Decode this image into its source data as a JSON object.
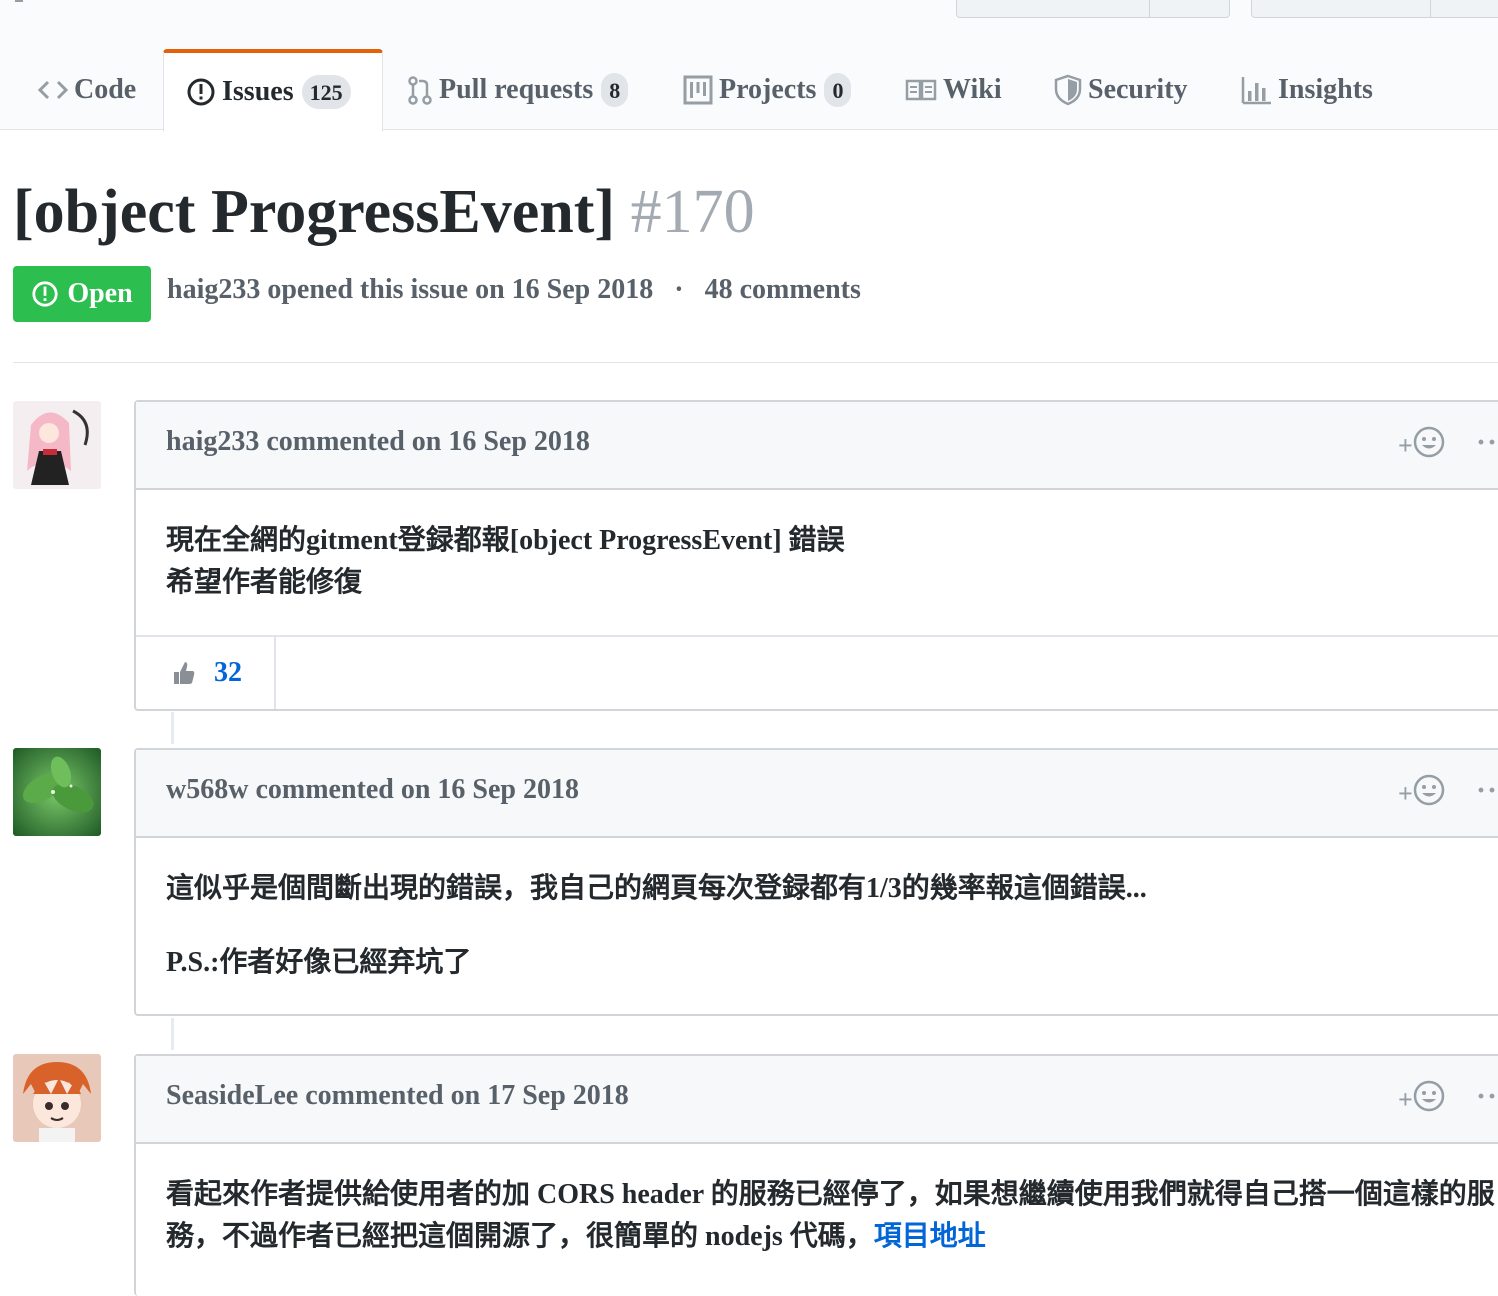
{
  "tabs": [
    {
      "label": "Code",
      "icon": "code-icon"
    },
    {
      "label": "Issues",
      "icon": "issue-opened-icon",
      "count": "125",
      "selected": true
    },
    {
      "label": "Pull requests",
      "icon": "git-pull-request-icon",
      "count": "8"
    },
    {
      "label": "Projects",
      "icon": "project-icon",
      "count": "0"
    },
    {
      "label": "Wiki",
      "icon": "book-icon"
    },
    {
      "label": "Security",
      "icon": "shield-icon"
    },
    {
      "label": "Insights",
      "icon": "graph-icon"
    }
  ],
  "issue": {
    "title": "[object ProgressEvent]",
    "number": "#170",
    "state": "Open",
    "author": "haig233",
    "opened_text": "opened this issue on 16 Sep 2018",
    "separator": "·",
    "comments_count": "48 comments"
  },
  "comments": [
    {
      "author": "haig233",
      "action": "commented",
      "date": "on 16 Sep 2018",
      "lines": [
        "現在全網的gitment登録都報[object ProgressEvent] 錯誤",
        "希望作者能修復"
      ],
      "reaction": {
        "icon": "thumbs-up-icon",
        "count": "32"
      }
    },
    {
      "author": "w568w",
      "action": "commented",
      "date": "on 16 Sep 2018",
      "lines": [
        "這似乎是個間斷出現的錯誤，我自己的網頁每次登録都有1/3的幾率報這個錯誤...",
        "P.S.:作者好像已經弃坑了"
      ]
    },
    {
      "author": "SeasideLee",
      "action": "commented",
      "date": "on 17 Sep 2018",
      "lines": [
        "看起來作者提供給使用者的加 CORS header 的服務已經停了，如果想繼續使用我們就得自己搭一個這樣的服",
        "務，不過作者已經把這個開源了，很簡單的 nodejs 代碼，"
      ],
      "link": "項目地址"
    }
  ],
  "reaction_add": "+",
  "more_actions": "···",
  "colors": {
    "accent": "#e36209",
    "open_green": "#2cbe4e",
    "link_blue": "#0366d6"
  }
}
